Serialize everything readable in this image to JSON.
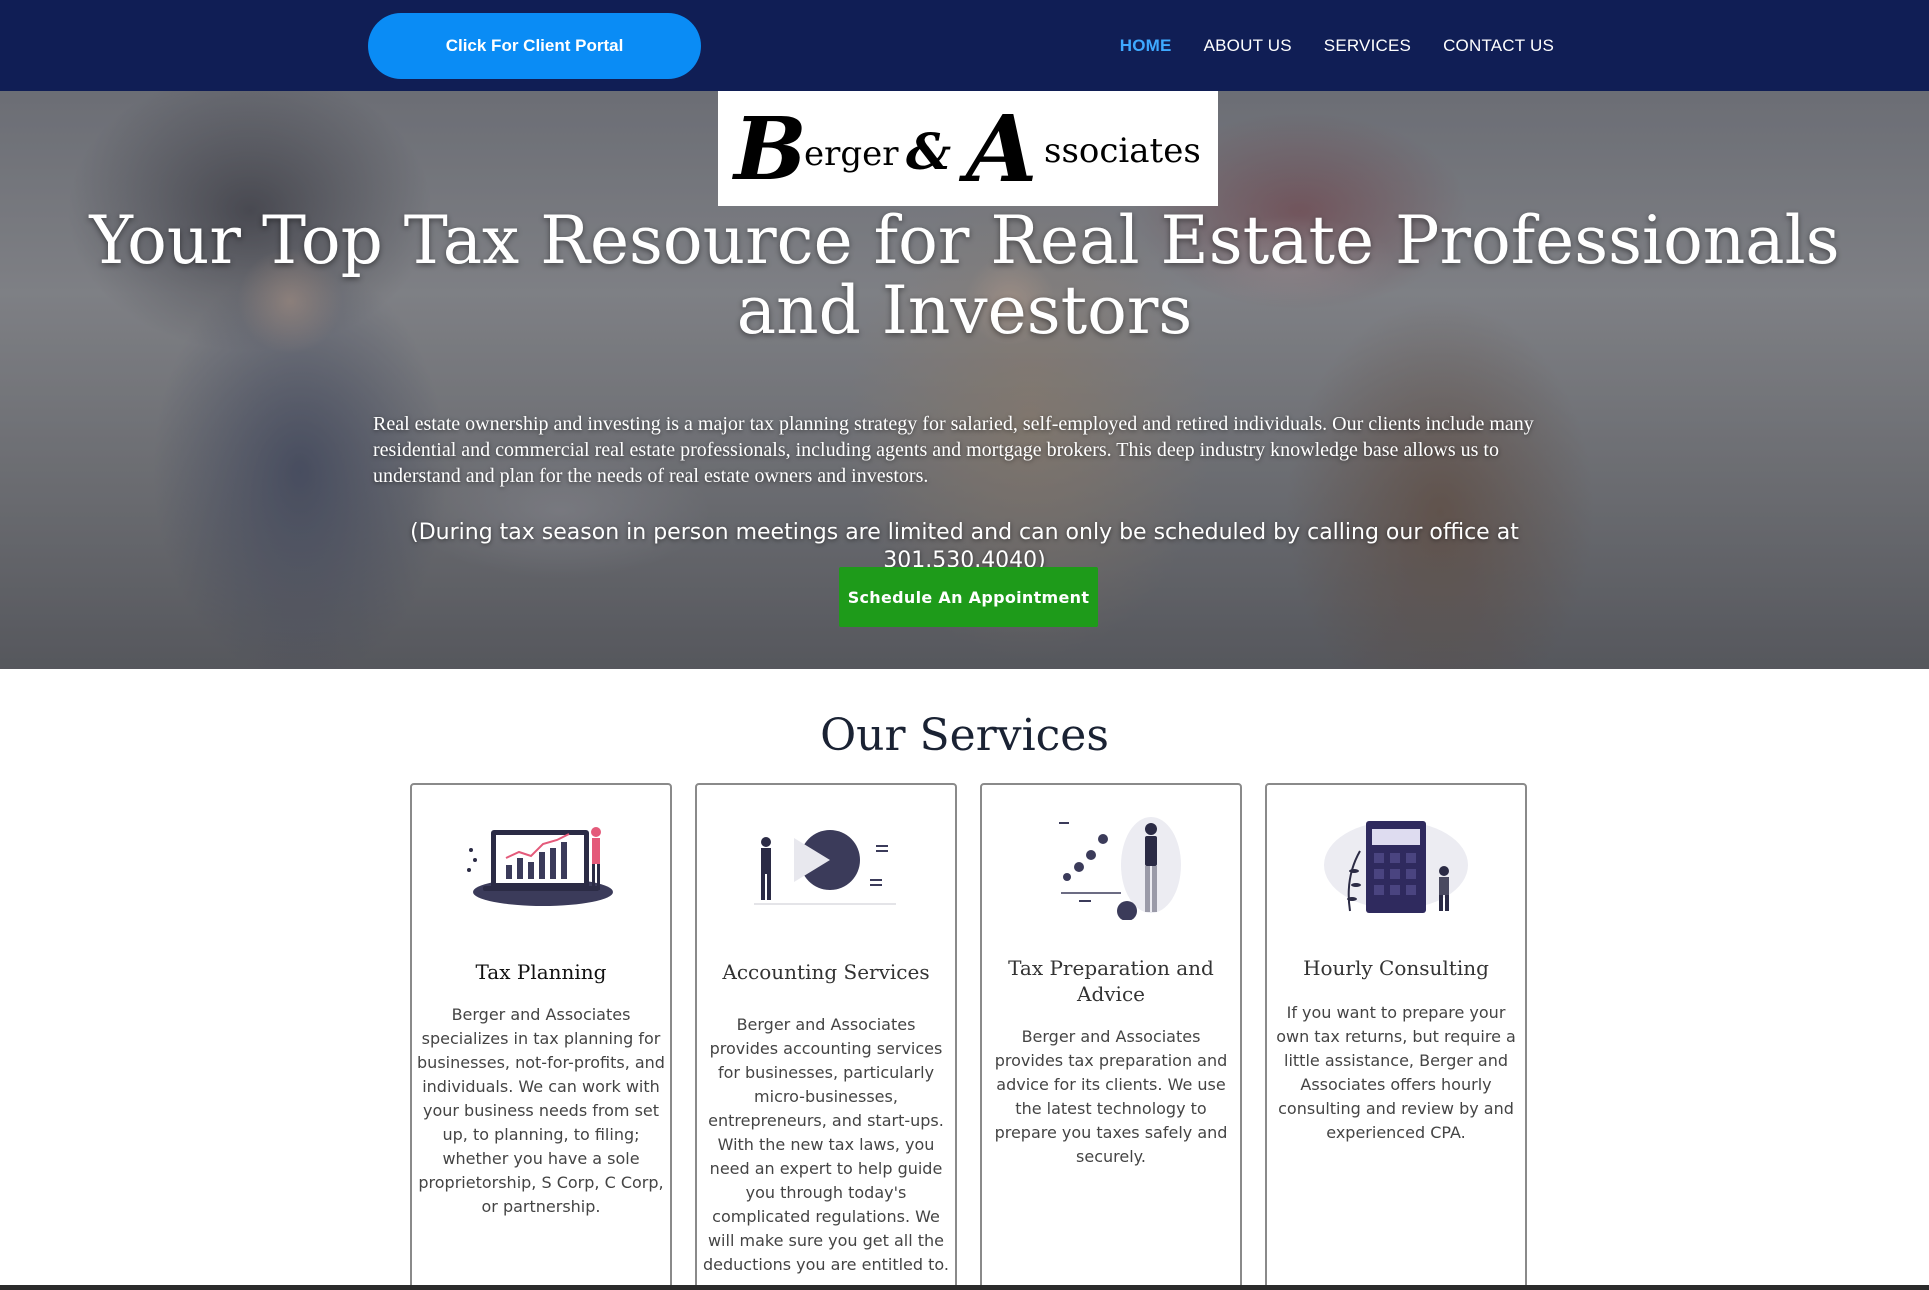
{
  "header": {
    "portal_button": "Click For Client Portal",
    "nav": [
      {
        "label": "HOME",
        "active": true
      },
      {
        "label": "ABOUT US",
        "active": false
      },
      {
        "label": "SERVICES",
        "active": false
      },
      {
        "label": "CONTACT US",
        "active": false
      }
    ],
    "colors": {
      "bar": "#101e55",
      "portal": "#0a8cf5",
      "active_link": "#3ea9ff"
    }
  },
  "hero": {
    "logo_text": "Berger & Associates",
    "title": "Your Top Tax Resource for Real Estate Professionals and Investors",
    "description": "Real estate ownership and investing is a major tax planning strategy for salaried, self-employed and retired individuals. Our clients include many residential and commercial real estate professionals, including agents and mortgage brokers. This deep industry knowledge base allows us to understand and plan for the needs of real estate owners and investors.",
    "note": "(During tax season in person meetings are limited and can only be scheduled by calling our office at 301.530.4040)",
    "appointment_button": "Schedule An Appointment",
    "button_color": "#1e9b1a"
  },
  "services": {
    "title": "Our Services",
    "cards": [
      {
        "icon": "laptop-chart-icon",
        "title": "Tax Planning",
        "text": "Berger and Associates specializes in tax planning for businesses, not-for-profits, and individuals. We can work with your business needs from set up, to planning, to filing; whether you have a sole proprietorship, S Corp, C Corp, or partnership."
      },
      {
        "icon": "presentation-icon",
        "title": "Accounting Services",
        "text": "Berger and Associates provides accounting services for businesses, particularly micro-businesses, entrepreneurs, and start-ups. With the new tax laws, you need an expert to help guide you through today's complicated regulations. We will make sure you get all the deductions you are entitled to."
      },
      {
        "icon": "data-points-icon",
        "title": "Tax Preparation and Advice",
        "text": "Berger and Associates provides tax preparation and advice for its clients. We use the latest technology to prepare you taxes safely and securely."
      },
      {
        "icon": "calculator-icon",
        "title": "Hourly Consulting",
        "text": "If you want to prepare your own tax returns, but require a little assistance, Berger and Associates offers hourly consulting and review by and experienced CPA."
      }
    ]
  }
}
